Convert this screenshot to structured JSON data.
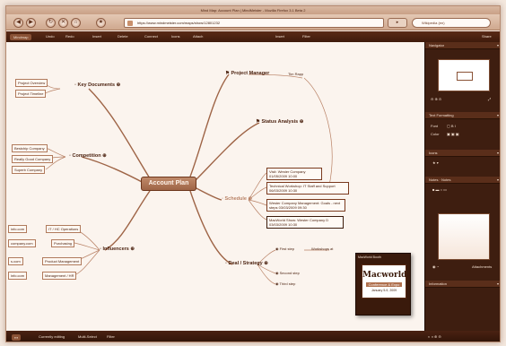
{
  "window": {
    "title": "Mind Map: Account Plan | MindMeister - Mozilla Firefox 3.1 Beta 2"
  },
  "browser": {
    "back_label": "◀",
    "forward_label": "▶",
    "reload_label": "↻",
    "stop_label": "✕",
    "home_label": "⌂",
    "url": "https://www.mindmeister.com/maps/show/12801232",
    "go_label": "▸",
    "search_placeholder": "Wikipedia (en)"
  },
  "app_toolbar": {
    "items": [
      "Undo",
      "Redo",
      "Insert",
      "Delete",
      "Connect",
      "Icons",
      "Attach",
      "Insert",
      "Filter",
      "Share"
    ],
    "active_tab": "Mindmap"
  },
  "mindmap": {
    "center": "Account Plan",
    "branches": {
      "key_documents": "Key Documents",
      "competition": "Competition",
      "influencers": "Influencers",
      "project_manager": "Project Manager",
      "status_analysis": "Status Analysis",
      "schedule": "Schedule",
      "deal_strategy": "Deal / Strategy"
    },
    "leaves": {
      "key_documents": [
        "Project Overview",
        "Project Timeline"
      ],
      "competition": [
        "Bestchip Company",
        "Really Good Company",
        "Superb Company"
      ],
      "influencers": [
        "IT / HC Operations",
        "Purchasing",
        "Product Management",
        "Management / HR"
      ],
      "influencer_contacts": [
        "info.com",
        "company.com",
        "s.com",
        "info.com"
      ],
      "project_manager_child": "Tim Rapp",
      "schedule": [
        "Visit: Wester Company 01/05/2009 10:00",
        "Technical Workshop: IT Staff and Support 06/03/2009 10:30",
        "Wester Company Management: Goals - next steps 03/03/2009 09:30",
        "MacWorld Show: Wester Company D 03/03/2009 10:30"
      ],
      "deal_strategy": [
        "First step",
        "Second step",
        "Third step"
      ],
      "first_step_child": "Workshops at"
    }
  },
  "popup": {
    "title": "MacWorld Booth",
    "logo": "Macworld",
    "band": "Conference & Expo",
    "date": "January 5-9, 2009"
  },
  "inspector": {
    "navigator": "Navigator",
    "text_formatting": "Text Formatting",
    "font_label": "Font",
    "color_label": "Color",
    "icons": "Icons",
    "notes": "Notes",
    "notes_sub": "Notes",
    "attachments": "Attachments",
    "information": "Information"
  },
  "status": {
    "mode": "Currently editing",
    "items": [
      "Multi-Select",
      "Filter"
    ]
  }
}
